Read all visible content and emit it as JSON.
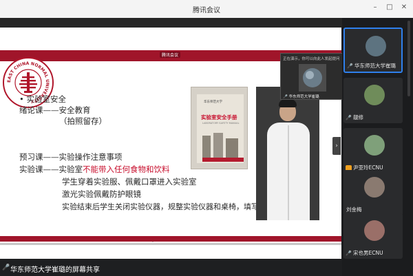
{
  "window": {
    "title": "腾讯会议"
  },
  "slide": {
    "share_hint": "腾讯会议",
    "lines": {
      "l1": "• 实验室安全",
      "l2": "绪论课——安全教育",
      "l3": "（拍照留存）",
      "l4": "预习课——实验操作注意事项",
      "l5a": "实验课——实验室",
      "l5b": "不能带入任何食物和饮料",
      "l6": "学生穿着实验服、佩戴口罩进入实验室",
      "l7": "激光实验佩戴防护眼镜",
      "l8": "实验结束后学生关闭实验仪器，规整实验仪器和桌椅，填写实验记录本"
    },
    "book": {
      "university": "华东师范大学",
      "title": "实验室安全手册",
      "subtitle": "LABORATORY SAFETY MANUAL"
    },
    "logo_ring_text": "EAST CHINA NORMAL UNIVERSITY",
    "colors": {
      "brand_red": "#a0152a",
      "text_red": "#c8102e"
    }
  },
  "overlay": {
    "hint": "正在演示，你可以向此人发起提问",
    "label": "华东师范大学崔璐"
  },
  "participants": [
    {
      "name": "华东师范大学崔璐",
      "icon": "mic-icon"
    },
    {
      "name": "靓修",
      "icon": "mic-icon"
    },
    {
      "name": "尹亚玲ECNU",
      "icon": "status-badge"
    },
    {
      "name": "刘金梅",
      "icon": "none"
    },
    {
      "name": "宋也男ECNU",
      "icon": "mic-icon"
    }
  ],
  "bottom": {
    "share_label": "华东师范大学崔璐的屏幕共享"
  }
}
